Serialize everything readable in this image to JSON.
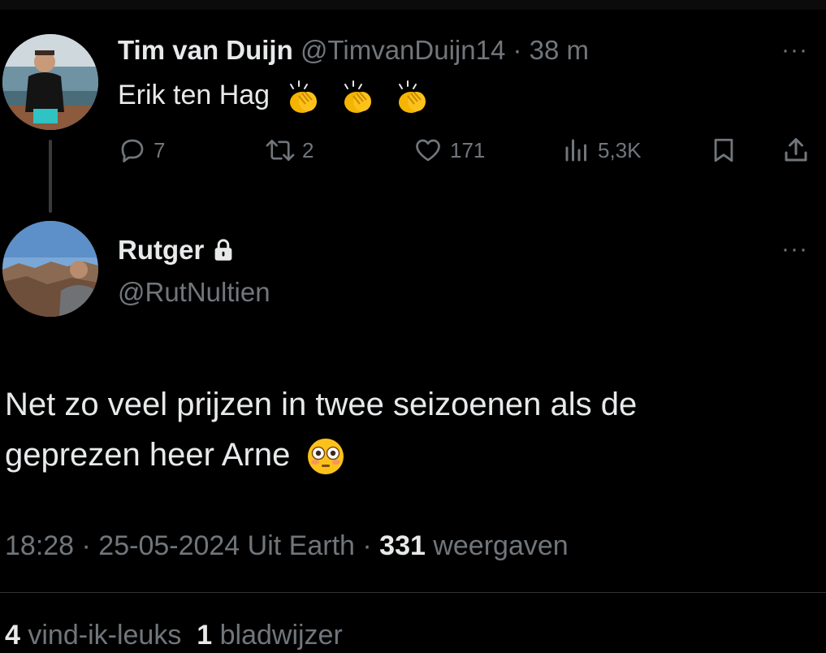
{
  "parent_tweet": {
    "author_name": "Tim van Duijn",
    "handle": "@TimvanDuijn14",
    "separator": "·",
    "time": "38 m",
    "text": "Erik ten Hag",
    "emojis": [
      "clapping-hands",
      "clapping-hands",
      "clapping-hands"
    ],
    "more_label": "···",
    "actions": {
      "replies": "7",
      "retweets": "2",
      "likes": "171",
      "views": "5,3K"
    }
  },
  "reply_tweet": {
    "author_name": "Rutger",
    "protected_icon": "lock-icon",
    "handle": "@RutNultien",
    "more_label": "···",
    "text_line1": "Net zo veel prijzen in twee seizoenen als de",
    "text_line2": "geprezen heer Arne",
    "emoji": "flushed-face",
    "timestamp": "18:28 · 25-05-2024 Uit Earth",
    "meta_sep": " · ",
    "views_count": "331",
    "views_label": "weergaven",
    "likes_count": "4",
    "likes_label": "vind-ik-leuks",
    "bookmarks_count": "1",
    "bookmarks_label": "bladwijzer"
  },
  "colors": {
    "background": "#000000",
    "primary_text": "#e7e9ea",
    "secondary_text": "#71767b",
    "divider": "#2f3336",
    "thread_line": "#3a3a3a"
  }
}
